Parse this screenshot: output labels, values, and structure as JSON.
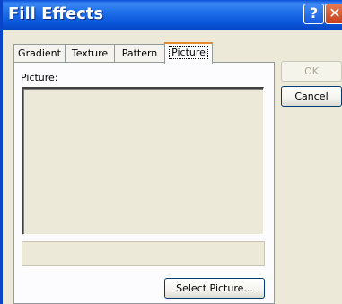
{
  "window": {
    "title": "Fill Effects",
    "help_glyph": "?",
    "close_glyph": "✕"
  },
  "tabs": [
    {
      "label": "Gradient",
      "active": false
    },
    {
      "label": "Texture",
      "active": false
    },
    {
      "label": "Pattern",
      "active": false
    },
    {
      "label": "Picture",
      "active": true
    }
  ],
  "picture_tab": {
    "picture_label": "Picture:",
    "picture_name": "",
    "select_button_label": "Select Picture..."
  },
  "buttons": {
    "ok_label": "OK",
    "ok_enabled": false,
    "cancel_label": "Cancel"
  },
  "colors": {
    "title_bar": "#0a58dc",
    "dialog_face": "#ece9d8",
    "active_tab_accent": "#e68b2c",
    "close_button": "#c3401c"
  },
  "icons": {
    "help": "help-icon",
    "close": "close-icon"
  }
}
